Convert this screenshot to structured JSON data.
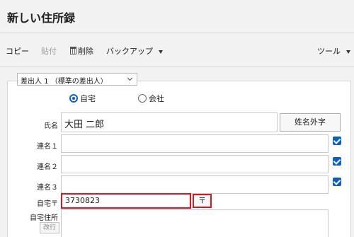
{
  "window": {
    "title": "新しい住所録"
  },
  "toolbar": {
    "copy": "コピー",
    "paste": "貼付",
    "delete": "削除",
    "backup": "バックアップ",
    "tools": "ツール"
  },
  "sender": {
    "selected": "差出人 1 （標準の差出人）"
  },
  "address_type": {
    "home": "自宅",
    "company": "会社",
    "selected": "自宅"
  },
  "form": {
    "name_label": "氏名",
    "name_value": "大田 二郎",
    "gaiji_button": "姓名外字",
    "joint1_label": "連名１",
    "joint2_label": "連名２",
    "joint3_label": "連名３",
    "postal_label": "自宅〒",
    "postal_value": "3730823",
    "postal_button": "〒",
    "address_label": "自宅住所",
    "newline_button": "改行"
  },
  "colors": {
    "accent": "#0a5fc7",
    "highlight": "#e0141e"
  }
}
